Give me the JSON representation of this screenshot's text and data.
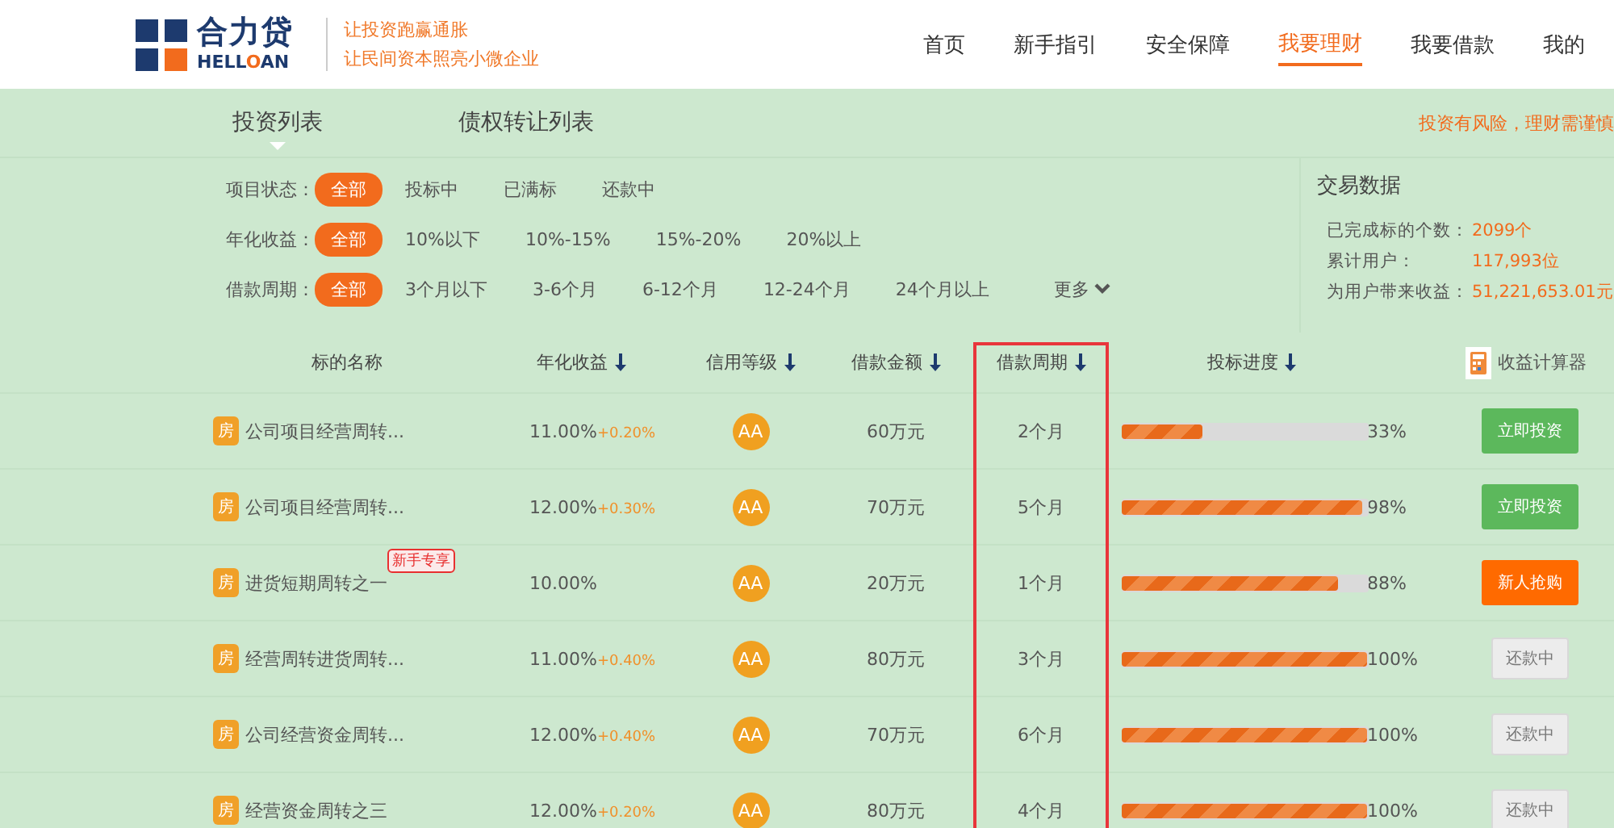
{
  "header": {
    "logo": {
      "name": "合力贷",
      "latin_start": "HELL",
      "latin_accent": "O",
      "latin_end": "AN"
    },
    "taglines": [
      "让投资跑赢通胀",
      "让民间资本照亮小微企业"
    ],
    "nav": [
      {
        "label": "首页",
        "selected": false
      },
      {
        "label": "新手指引",
        "selected": false
      },
      {
        "label": "安全保障",
        "selected": false
      },
      {
        "label": "我要理财",
        "selected": true
      },
      {
        "label": "我要借款",
        "selected": false
      },
      {
        "label": "我的",
        "selected": false
      }
    ]
  },
  "tabs": [
    {
      "label": "投资列表",
      "selected": true
    },
    {
      "label": "债权转让列表",
      "selected": false
    }
  ],
  "risk_note": "投资有风险，理财需谨慎",
  "filters": [
    {
      "label": "项目状态：",
      "options": [
        {
          "label": "全部",
          "selected": true
        },
        {
          "label": "投标中",
          "selected": false
        },
        {
          "label": "已满标",
          "selected": false
        },
        {
          "label": "还款中",
          "selected": false
        }
      ]
    },
    {
      "label": "年化收益：",
      "options": [
        {
          "label": "全部",
          "selected": true
        },
        {
          "label": "10%以下",
          "selected": false
        },
        {
          "label": "10%-15%",
          "selected": false
        },
        {
          "label": "15%-20%",
          "selected": false
        },
        {
          "label": "20%以上",
          "selected": false
        }
      ]
    },
    {
      "label": "借款周期：",
      "options": [
        {
          "label": "全部",
          "selected": true
        },
        {
          "label": "3个月以下",
          "selected": false
        },
        {
          "label": "3-6个月",
          "selected": false
        },
        {
          "label": "6-12个月",
          "selected": false
        },
        {
          "label": "12-24个月",
          "selected": false
        },
        {
          "label": "24个月以上",
          "selected": false
        }
      ],
      "more": "更多"
    }
  ],
  "stats": {
    "title": "交易数据",
    "items": [
      {
        "label": "已完成标的个数：",
        "value": "2099个"
      },
      {
        "label": "累计用户：",
        "value": "117,993位"
      },
      {
        "label": "为用户带来收益：",
        "value": "51,221,653.01元"
      }
    ]
  },
  "table": {
    "columns": [
      "标的名称",
      "年化收益",
      "信用等级",
      "借款金额",
      "借款周期",
      "投标进度"
    ],
    "calculator": "收益计算器",
    "rows": [
      {
        "type_icon": "房",
        "name": "公司项目经营周转...",
        "rate": "11.00%",
        "bonus": "+0.20%",
        "grade": "AA",
        "amount": "60万元",
        "period": "2个月",
        "level": 0.33,
        "percent": "33%",
        "action": {
          "kind": "invest",
          "label": "立即投资"
        }
      },
      {
        "type_icon": "房",
        "name": "公司项目经营周转...",
        "rate": "12.00%",
        "bonus": "+0.30%",
        "grade": "AA",
        "amount": "70万元",
        "period": "5个月",
        "level": 0.98,
        "percent": "98%",
        "action": {
          "kind": "invest",
          "label": "立即投资"
        }
      },
      {
        "type_icon": "房",
        "name": "进货短期周转之一",
        "badge": "新手专享",
        "rate": "10.00%",
        "grade": "AA",
        "amount": "20万元",
        "period": "1个月",
        "level": 0.88,
        "percent": "88%",
        "action": {
          "kind": "newbie",
          "label": "新人抢购"
        }
      },
      {
        "type_icon": "房",
        "name": "经营周转进货周转...",
        "rate": "11.00%",
        "bonus": "+0.40%",
        "grade": "AA",
        "amount": "80万元",
        "period": "3个月",
        "level": 1,
        "percent": "100%",
        "action": {
          "kind": "repaying",
          "label": "还款中"
        }
      },
      {
        "type_icon": "房",
        "name": "公司经营资金周转...",
        "rate": "12.00%",
        "bonus": "+0.40%",
        "grade": "AA",
        "amount": "70万元",
        "period": "6个月",
        "level": 1,
        "percent": "100%",
        "action": {
          "kind": "repaying",
          "label": "还款中"
        }
      },
      {
        "type_icon": "房",
        "name": "经营资金周转之三",
        "rate": "12.00%",
        "bonus": "+0.20%",
        "grade": "AA",
        "amount": "80万元",
        "period": "4个月",
        "level": 1,
        "percent": "100%",
        "action": {
          "kind": "repaying",
          "label": "还款中"
        }
      }
    ]
  }
}
